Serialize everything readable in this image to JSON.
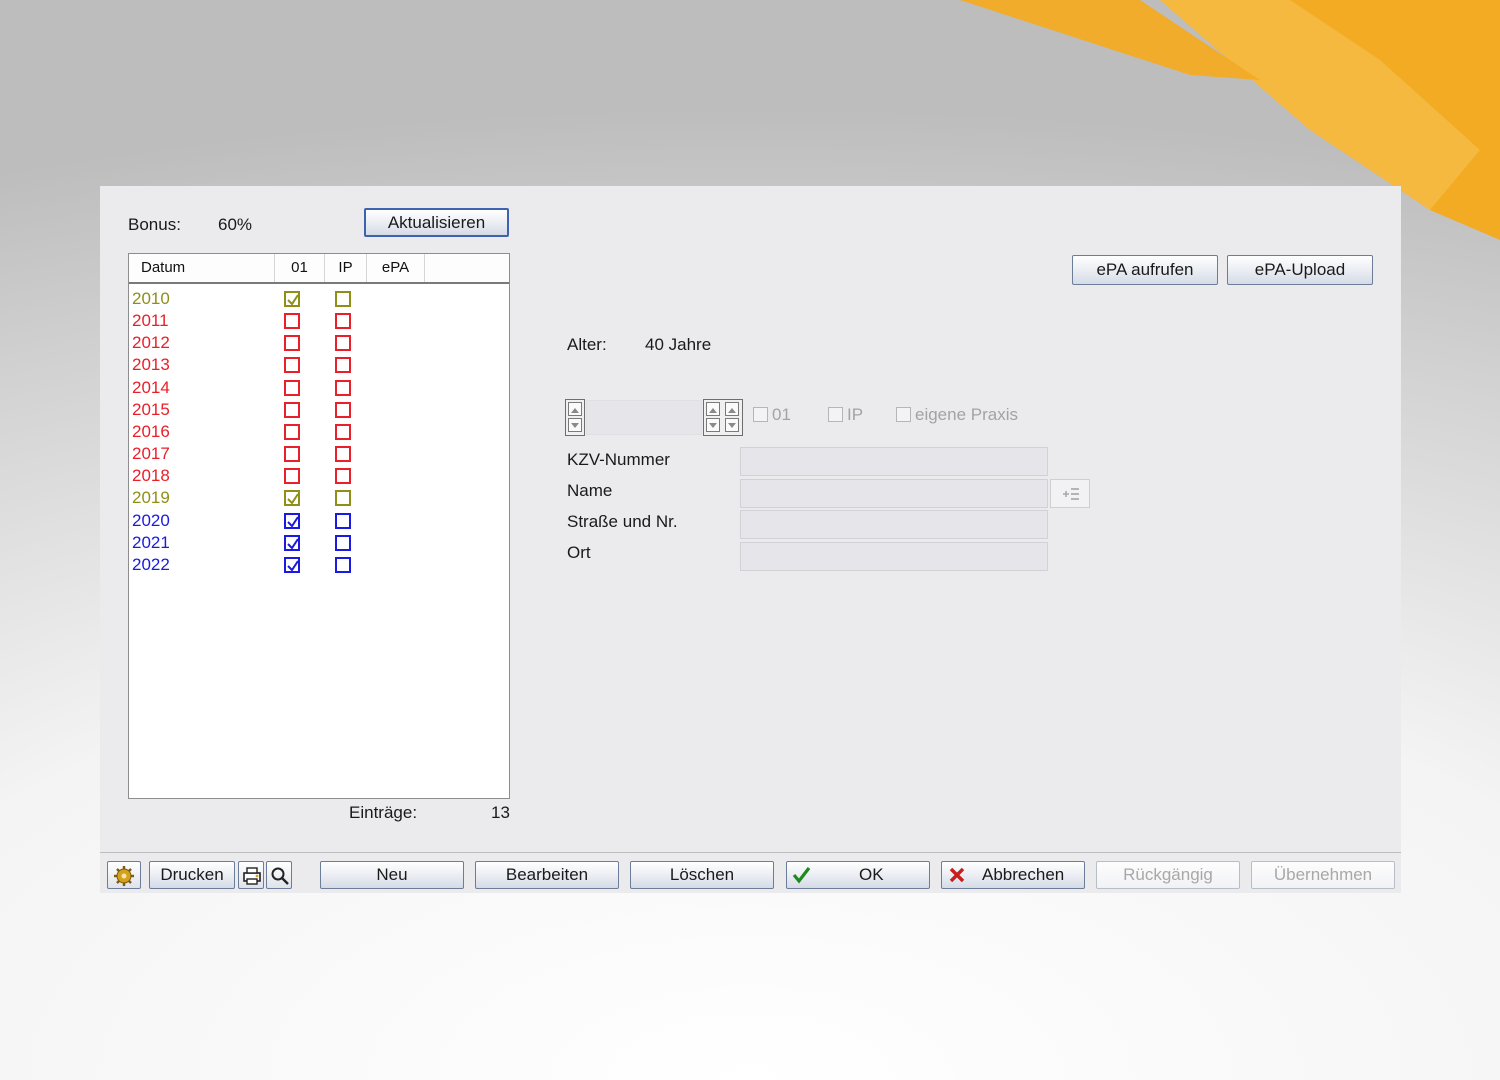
{
  "bonus": {
    "label": "Bonus:",
    "value": "60%",
    "refresh_button": "Aktualisieren"
  },
  "list": {
    "columns": [
      "Datum",
      "01",
      "IP",
      "ePA"
    ],
    "rows": [
      {
        "year": "2010",
        "c01": true,
        "ip": false,
        "color": "#8f8f17"
      },
      {
        "year": "2011",
        "c01": false,
        "ip": false,
        "color": "#e8202a"
      },
      {
        "year": "2012",
        "c01": false,
        "ip": false,
        "color": "#e8202a"
      },
      {
        "year": "2013",
        "c01": false,
        "ip": false,
        "color": "#e8202a"
      },
      {
        "year": "2014",
        "c01": false,
        "ip": false,
        "color": "#e8202a"
      },
      {
        "year": "2015",
        "c01": false,
        "ip": false,
        "color": "#e8202a"
      },
      {
        "year": "2016",
        "c01": false,
        "ip": false,
        "color": "#e8202a"
      },
      {
        "year": "2017",
        "c01": false,
        "ip": false,
        "color": "#e8202a"
      },
      {
        "year": "2018",
        "c01": false,
        "ip": false,
        "color": "#e8202a"
      },
      {
        "year": "2019",
        "c01": true,
        "ip": false,
        "color": "#8f8f17"
      },
      {
        "year": "2020",
        "c01": true,
        "ip": false,
        "color": "#1a1ae0"
      },
      {
        "year": "2021",
        "c01": true,
        "ip": false,
        "color": "#1a1ae0"
      },
      {
        "year": "2022",
        "c01": true,
        "ip": false,
        "color": "#1a1ae0"
      }
    ],
    "entries_label": "Einträge:",
    "entries_count": "13"
  },
  "epa": {
    "open_button": "ePA aufrufen",
    "upload_button": "ePA-Upload"
  },
  "age": {
    "label": "Alter:",
    "value": "40 Jahre"
  },
  "options": {
    "cb_01": "01",
    "cb_ip": "IP",
    "cb_own_practice": "eigene Praxis"
  },
  "form": {
    "kzv_label": "KZV-Nummer",
    "name_label": "Name",
    "street_label": "Straße und Nr.",
    "city_label": "Ort"
  },
  "toolbar": {
    "print": "Drucken",
    "new": "Neu",
    "edit": "Bearbeiten",
    "delete": "Löschen",
    "ok": "OK",
    "cancel": "Abbrechen",
    "undo": "Rückgängig",
    "apply": "Übernehmen"
  },
  "colors": {
    "accent_orange": "#f2ab22",
    "selected_border": "#3d63b0"
  }
}
